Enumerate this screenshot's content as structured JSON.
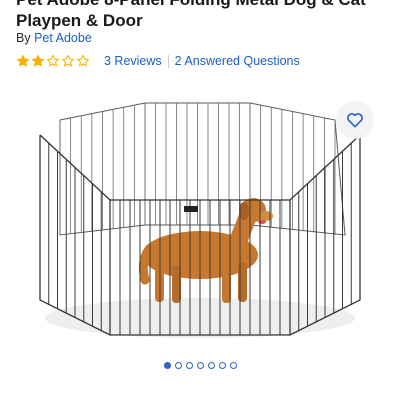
{
  "product": {
    "title": "Pet Adobe 8-Panel Folding Metal Dog & Cat Playpen & Door",
    "by_prefix": "By",
    "brand": "Pet Adobe",
    "rating": 2,
    "rating_max": 5,
    "reviews_link": "3 Reviews",
    "questions_link": "2 Answered Questions"
  },
  "gallery": {
    "image_count": 7,
    "active_index": 0
  },
  "colors": {
    "link": "#1b5fc1",
    "star_fill": "#f5b301",
    "accent": "#2b63c6"
  },
  "icons": {
    "favorite": "heart-outline-icon",
    "star_filled": "star-filled-icon",
    "star_empty": "star-outline-icon"
  }
}
